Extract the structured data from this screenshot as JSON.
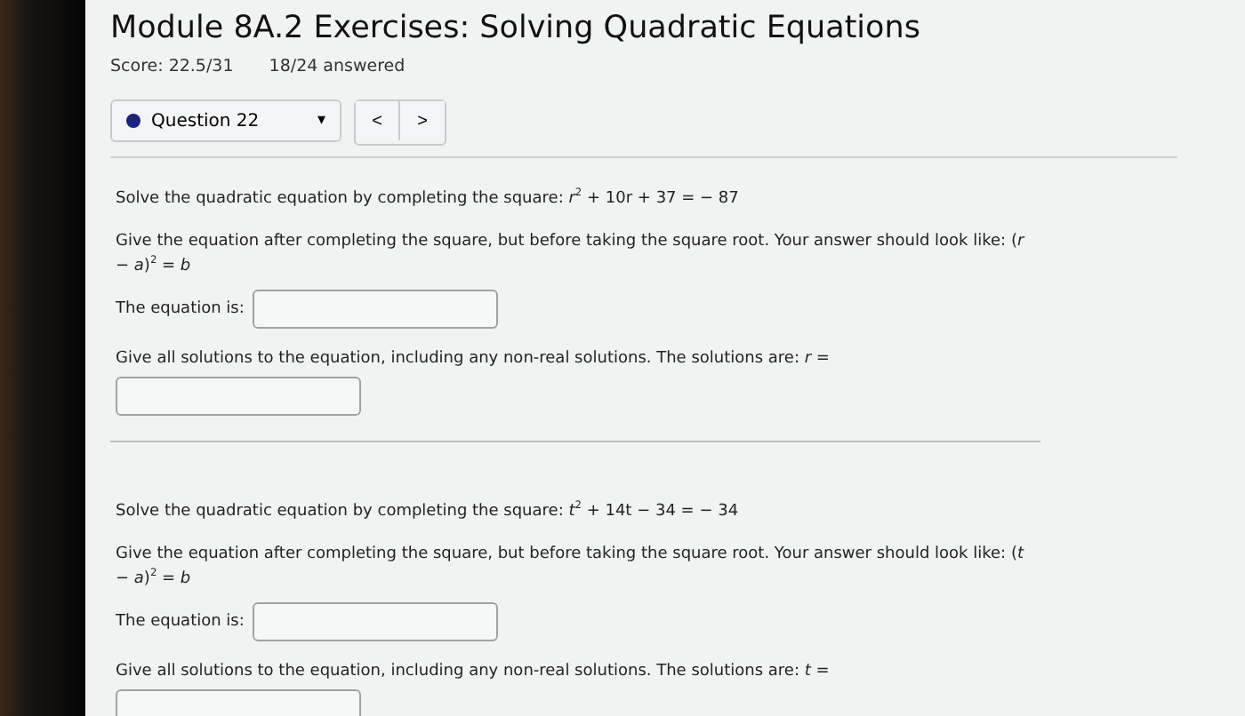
{
  "title": "Module 8A.2 Exercises: Solving Quadratic Equations",
  "score": "Score: 22.5/31",
  "answered": "18/24 answered",
  "question_select": {
    "label": "Question 22",
    "caret": "▾"
  },
  "nav_buttons": [
    "<",
    ">"
  ],
  "questions": [
    {
      "prompt": "Solve the quadratic equation by completing the square: *r*$^{2}$ + 10r + 37 = − 87",
      "instruction": "Give the equation after completing the square, but before taking the square root. Your answer should look like: (*r* − *a*)$^{2}$ = *b*",
      "equation_label": "The equation is:",
      "solutions_label": "Give all solutions to the equation, including any non-real solutions. The solutions are: *r* ="
    },
    {
      "prompt": "Solve the quadratic equation by completing the square: *t*$^{2}$ + 14t − 34 = − 34",
      "instruction": "Give the equation after completing the square, but before taking the square root. Your answer should look like: (*t* − *a*)$^{2}$ = *b*",
      "equation_label": "The equation is:",
      "solutions_label": "Give all solutions to the equation, including any non-real solutions. The solutions are: *t* ="
    }
  ]
}
